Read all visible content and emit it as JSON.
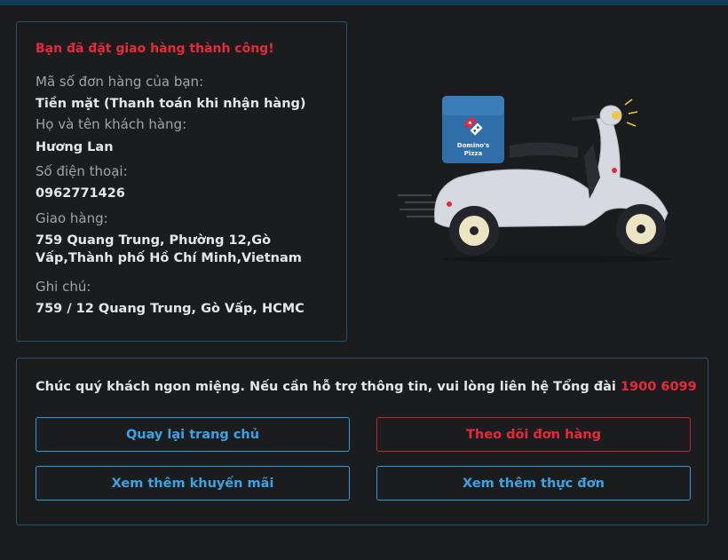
{
  "order": {
    "success_message": "Bạn đã đặt giao hàng thành công!",
    "order_number_label": "Mã số đơn hàng của bạn:",
    "order_number_value": "Tiền mặt (Thanh toán khi nhận hàng)",
    "name_label": "Họ và tên khách hàng:",
    "name_value": "Hương Lan",
    "phone_label": "Số điện thoại:",
    "phone_value": "0962771426",
    "delivery_label": "Giao hàng:",
    "delivery_value": "759 Quang Trung, Phường 12,Gò Vấp,Thành phố Hồ Chí Minh,Vietnam",
    "note_label": "Ghi chú:",
    "note_value": "759 / 12 Quang Trung, Gò Vấp, HCMC"
  },
  "illustration": {
    "box_brand_line1": "Domino's",
    "box_brand_line2": "Pizza"
  },
  "support": {
    "message": "Chúc quý khách ngon miệng. Nếu cần hỗ trợ thông tin, vui lòng liên hệ Tổng đài",
    "hotline": "1900 6099"
  },
  "actions": {
    "home": "Quay lại trang chủ",
    "track": "Theo dõi đơn hàng",
    "promotions": "Xem thêm khuyến mãi",
    "menu": "Xem thêm thực đơn"
  },
  "colors": {
    "accent_red": "#e8283c",
    "accent_blue": "#2c9bd9",
    "background": "#1b1c1e"
  }
}
